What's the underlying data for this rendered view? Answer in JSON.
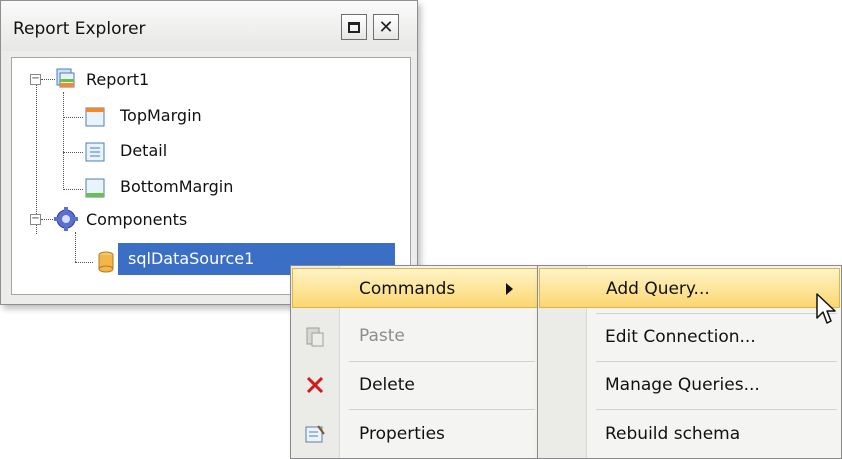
{
  "explorer": {
    "title": "Report Explorer",
    "maximize_icon": "maximize-icon",
    "close_icon": "close-icon",
    "nodes": {
      "report": "Report1",
      "top_margin": "TopMargin",
      "detail": "Detail",
      "bottom_margin": "BottomMargin",
      "components": "Components",
      "sql_data_source": "sqlDataSource1"
    },
    "colors": {
      "selection": "#3b6fc6"
    }
  },
  "context_menu": {
    "items": [
      {
        "label": "Commands",
        "icon": "none",
        "highlighted": true,
        "submenu": true
      },
      {
        "label": "Paste",
        "icon": "paste-icon",
        "disabled": true
      },
      {
        "label": "Delete",
        "icon": "delete-icon"
      },
      {
        "label": "Properties",
        "icon": "properties-icon"
      }
    ]
  },
  "submenu": {
    "items": [
      {
        "label": "Add Query...",
        "highlighted": true
      },
      {
        "label": "Edit Connection..."
      },
      {
        "label": "Manage Queries..."
      },
      {
        "label": "Rebuild schema"
      }
    ]
  }
}
